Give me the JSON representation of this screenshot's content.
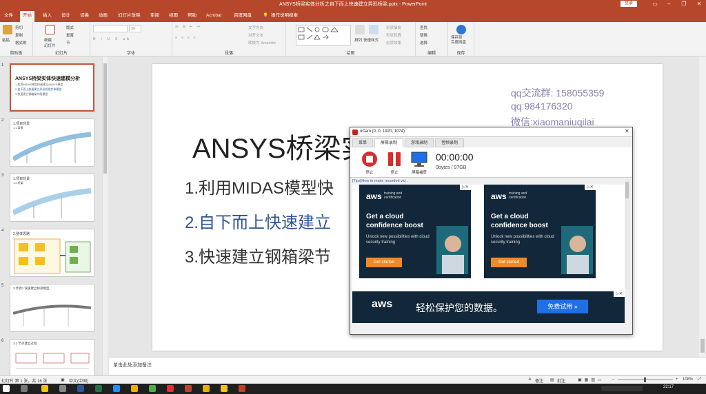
{
  "window": {
    "title": "ANSYS桥梁实体分析之自下而上快速建立异形桥梁.pptx  -  PowerPoint",
    "login": "登录"
  },
  "tabs": [
    "文件",
    "开始",
    "插入",
    "设计",
    "切换",
    "动画",
    "幻灯片放映",
    "审阅",
    "视图",
    "帮助",
    "Acrobat",
    "百度网盘",
    "操作说明搜索"
  ],
  "ribbon": {
    "clipboard": {
      "paste": "粘贴",
      "cut": "剪切",
      "copy": "复制",
      "format_painter": "格式刷",
      "label": "剪贴板"
    },
    "slides": {
      "new_slide": "新建\n幻灯片",
      "layout": "版式",
      "reset": "重置",
      "section": "节",
      "label": "幻灯片"
    },
    "font": {
      "font_size": "36",
      "label": "字体"
    },
    "paragraph": {
      "text_direction": "文字方向",
      "align_text": "对齐文本",
      "smartart": "转换为 SmartArt",
      "label": "段落"
    },
    "drawing": {
      "arrange": "排列",
      "quick_styles": "快速样式",
      "shape_fill": "形状填充",
      "shape_outline": "形状轮廓",
      "shape_effects": "形状效果",
      "label": "绘图"
    },
    "editing": {
      "find": "查找",
      "replace": "替换",
      "select": "选择",
      "label": "编辑"
    },
    "save": {
      "save_to_baidu": "保存到\n百度网盘",
      "label": "保存"
    }
  },
  "thumbnails": [
    {
      "num": "1",
      "lines": [
        "ANSYS桥梁实体快速建模分析",
        "1.利用MIDAS模型快速建立ANSYS模型",
        "2.自下而上快速建立异形桥梁实体模型",
        "3.快速建立钢箱梁节段模型"
      ]
    },
    {
      "num": "2",
      "lines": [
        "1.项目背景",
        "1.1 背景"
      ]
    },
    {
      "num": "3",
      "lines": [
        "1.项目背景",
        "1.2 桥梁"
      ]
    },
    {
      "num": "4",
      "lines": [
        "2.整体思路"
      ]
    },
    {
      "num": "5",
      "lines": [
        "3.步骤1 快速建立桥梁模型"
      ]
    },
    {
      "num": "6",
      "lines": [
        "3.1 节点建立过程"
      ]
    }
  ],
  "slide": {
    "qq_group": "qq交流群: 158055359",
    "qq": "qq:984176320",
    "wechat": "微信:xiaomaniuqilai",
    "title": "ANSYS桥梁实",
    "item1": "1.利用MIDAS模型快",
    "item2": "2.自下而上快速建立",
    "item3": "3.快速建立钢箱梁节"
  },
  "notes": {
    "placeholder": "单击此处添加备注"
  },
  "statusbar": {
    "slide_info": "幻灯片 第 1 张，共 16 张",
    "language": "中文(中国)",
    "notes_btn": "备注",
    "comments_btn": "批注",
    "zoom": "108%"
  },
  "ocam": {
    "title": "oCam (0, 0, 1920, 1074)",
    "tabs": [
      "菜单",
      "屏幕录制",
      "游戏录制",
      "音频录制"
    ],
    "tools": {
      "record": "停止",
      "pause": "停止",
      "screen": "屏幕捕获"
    },
    "timer": "00:00:00",
    "size": "0bytes / 97GB",
    "tips": "[Tips]How to make recorded vid..",
    "ad1": {
      "logo": "aws",
      "logosub": "training and certification",
      "head": "Get a cloud confidence boost",
      "body": "Unlock new possibilities with cloud security training",
      "cta": "Get started"
    },
    "ad2": {
      "logo": "aws",
      "logosub": "training and certification",
      "head": "Get a cloud confidence boost",
      "body": "Unlock new possibilities with cloud security training",
      "cta": "Get started"
    },
    "banner": {
      "logo": "aws",
      "text": "轻松保护您的数据。",
      "cta": "免费试用 »"
    }
  },
  "taskbar": {
    "time": "22:17"
  },
  "colors": {
    "ppt_accent": "#b7472a",
    "slide_blue": "#2e5596",
    "qq_color": "#8a7fb0",
    "aws_bg": "#12283a",
    "aws_orange": "#f08a24"
  }
}
